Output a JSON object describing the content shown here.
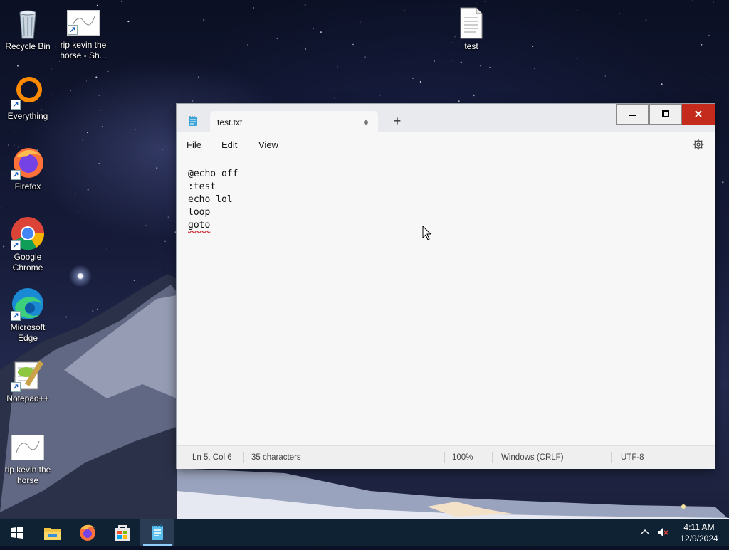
{
  "desktop": {
    "icons": [
      {
        "label": "Recycle Bin"
      },
      {
        "label": "rip kevin the horse - Sh..."
      },
      {
        "label": "test"
      },
      {
        "label": "Everything"
      },
      {
        "label": "Firefox"
      },
      {
        "label": "Google Chrome"
      },
      {
        "label": "Microsoft Edge"
      },
      {
        "label": "Notepad++"
      },
      {
        "label": "rip kevin the horse"
      }
    ]
  },
  "notepad": {
    "tab_title": "test.txt",
    "new_tab_symbol": "+",
    "menus": [
      "File",
      "Edit",
      "View"
    ],
    "lines": [
      "@echo off",
      ":test",
      "echo lol",
      "loop",
      "goto"
    ],
    "status": {
      "position": "Ln 5, Col 6",
      "characters": "35 characters",
      "zoom": "100%",
      "line_ending": "Windows (CRLF)",
      "encoding": "UTF-8"
    },
    "accent": "#c42b1c"
  },
  "taskbar": {
    "apps": [
      "start-icon",
      "file-explorer-icon",
      "firefox-icon",
      "microsoft-store-icon",
      "notepad-icon"
    ],
    "time": "4:11 AM",
    "date": "12/9/2024"
  }
}
